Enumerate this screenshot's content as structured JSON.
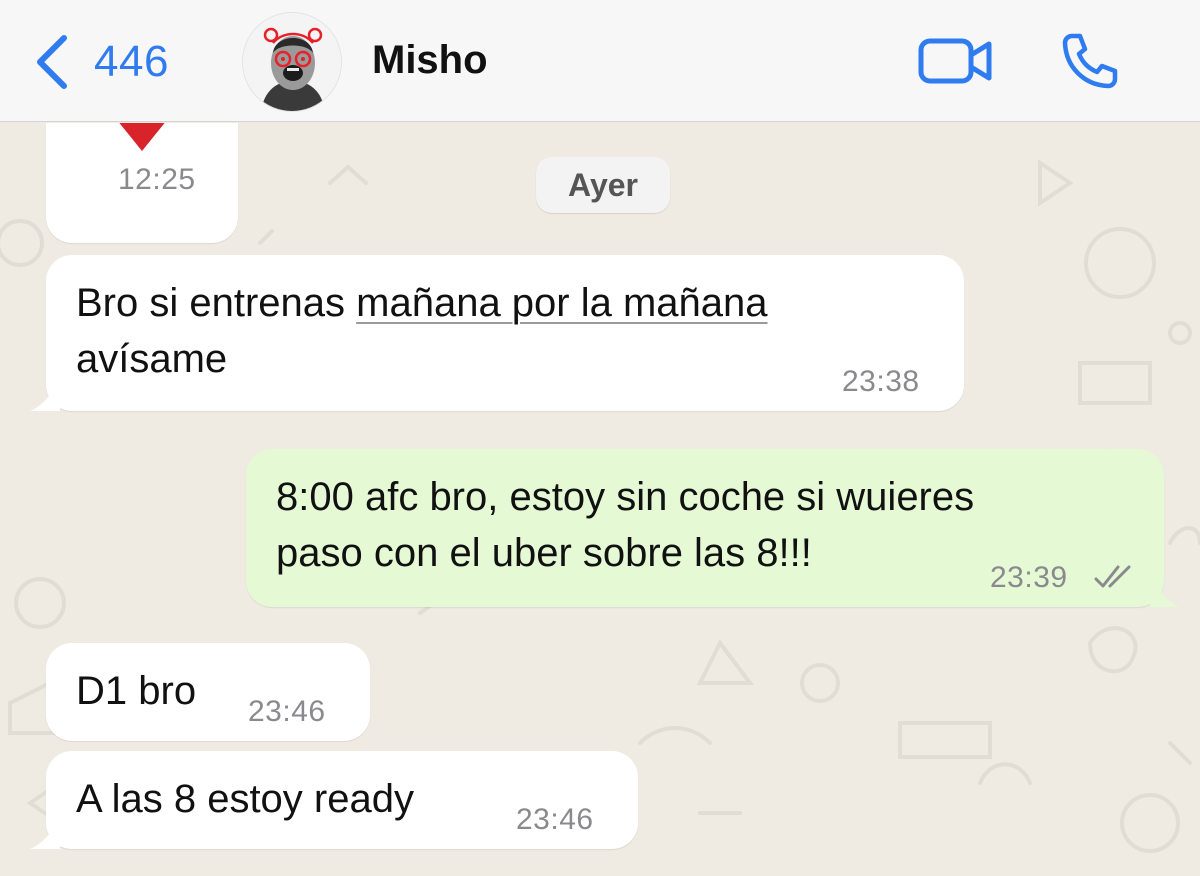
{
  "header": {
    "back_count": "446",
    "contact_name": "Misho"
  },
  "chat": {
    "date_separator": "Ayer",
    "messages": [
      {
        "direction": "in",
        "content": "❤️",
        "time": "12:25"
      },
      {
        "direction": "in",
        "text_prefix": "Bro si entrenas ",
        "text_link": "mañana por la mañana",
        "text_line2": "avísame",
        "time": "23:38"
      },
      {
        "direction": "out",
        "line1": "8:00 afc bro, estoy sin coche si wuieres",
        "line2": "paso con el uber sobre las 8!!!",
        "time": "23:39",
        "status": "double-check-icon"
      },
      {
        "direction": "in",
        "text": "D1 bro",
        "time": "23:46"
      },
      {
        "direction": "in",
        "text": "A las 8 estoy ready",
        "time": "23:46"
      }
    ]
  },
  "colors": {
    "accent": "#2f7bf0",
    "incoming_bubble": "#ffffff",
    "outgoing_bubble": "#e5f9d5",
    "wallpaper": "#efeae2",
    "heart": "#d8232a"
  }
}
